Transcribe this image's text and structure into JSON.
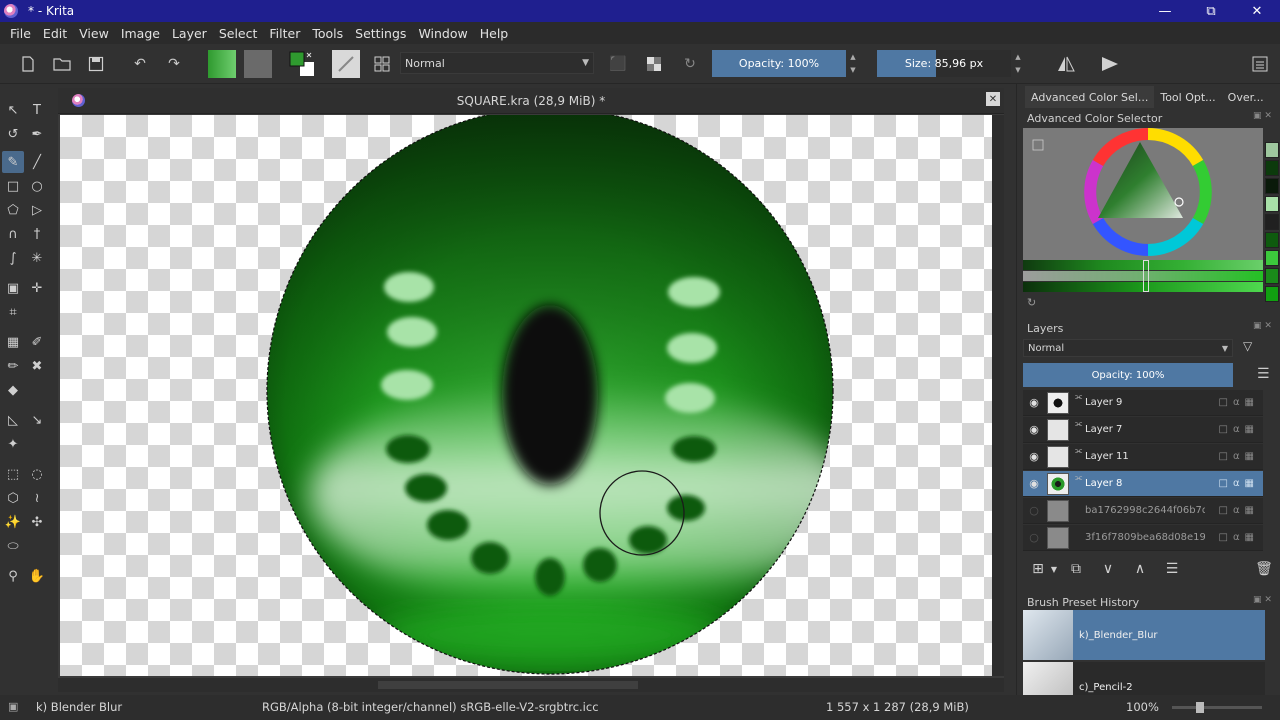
{
  "window": {
    "title": "* - Krita",
    "minimize": "—",
    "maximize": "⧉",
    "close": "✕"
  },
  "menu": [
    "File",
    "Edit",
    "View",
    "Image",
    "Layer",
    "Select",
    "Filter",
    "Tools",
    "Settings",
    "Window",
    "Help"
  ],
  "toolbar": {
    "blend_mode": "Normal",
    "opacity_label": "Opacity: 100%",
    "size_label": "Size: 85,96 px",
    "size_fraction": 0.44,
    "fg_color": "#2f9a2f",
    "bg_color": "#6a6a6a"
  },
  "document": {
    "tab_title": "SQUARE.kra (28,9 MiB) *"
  },
  "docker": {
    "tabs": [
      "Advanced Color Sel...",
      "Tool Opt...",
      "Over..."
    ],
    "color_selector_title": "Advanced Color Selector",
    "layers_title": "Layers",
    "layers_blend_mode": "Normal",
    "layers_opacity": "Opacity:  100%",
    "layers": [
      {
        "name": "Layer 9",
        "visible": true,
        "selected": false
      },
      {
        "name": "Layer 7",
        "visible": true,
        "selected": false
      },
      {
        "name": "Layer 11",
        "visible": true,
        "selected": false
      },
      {
        "name": "Layer 8",
        "visible": true,
        "selected": true
      },
      {
        "name": "ba1762998c2644f06b7d...",
        "visible": false,
        "selected": false
      },
      {
        "name": "3f16f7809bea68d08e199...",
        "visible": false,
        "selected": false
      }
    ],
    "preset_history_title": "Brush Preset History",
    "presets": [
      "k)_Blender_Blur",
      "c)_Pencil-2"
    ],
    "recent_colors": [
      "#9ec79e",
      "#0c3a0c",
      "#0a1a0a",
      "#a8e0a8",
      "#202020",
      "#0e5a0e",
      "#3cc83c",
      "#1a8a1a",
      "#11a011"
    ]
  },
  "status": {
    "brush": "k) Blender Blur",
    "color_model": "RGB/Alpha (8-bit integer/channel)  sRGB-elle-V2-srgbtrc.icc",
    "image_size": "1 557 x 1 287 (28,9 MiB)",
    "zoom": "100%"
  }
}
